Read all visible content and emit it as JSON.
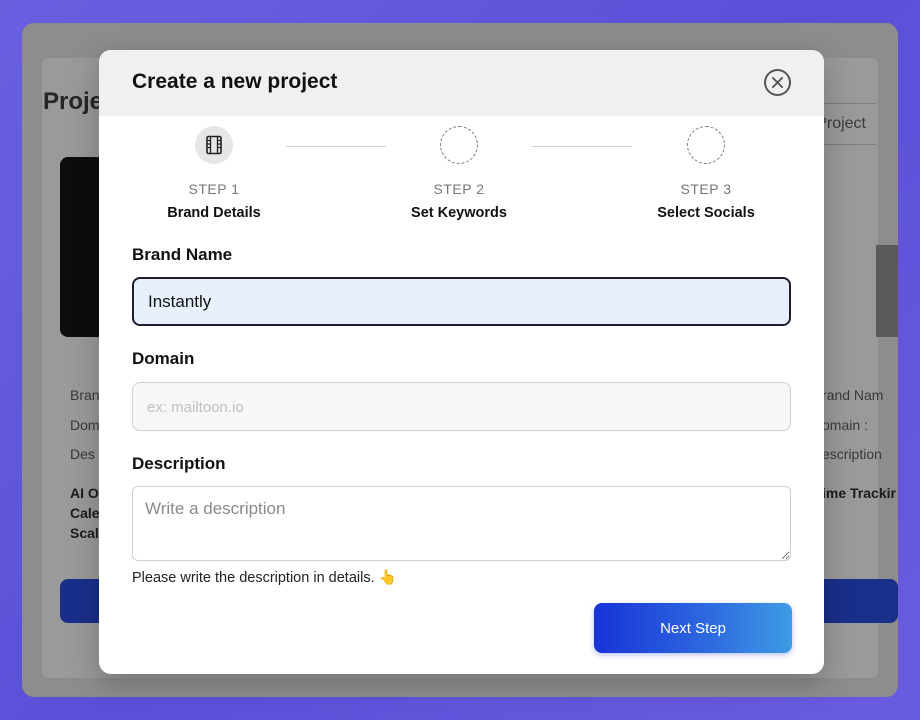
{
  "background": {
    "page_title": "Proje",
    "all_projects_label": "ll Project",
    "left_fields": [
      "Bran",
      "Dom",
      "Des"
    ],
    "left_tags": [
      "AI O",
      "Cale",
      "Scal"
    ],
    "right_fields": [
      "rand Nam",
      "omain :",
      "escription"
    ],
    "right_tags": [
      "ime Trackir"
    ]
  },
  "modal": {
    "title": "Create a new project",
    "close_icon": "close-icon",
    "steps": [
      {
        "number": "STEP 1",
        "label": "Brand Details",
        "state": "active",
        "icon": "film-icon"
      },
      {
        "number": "STEP 2",
        "label": "Set Keywords",
        "state": "pending"
      },
      {
        "number": "STEP 3",
        "label": "Select Socials",
        "state": "pending"
      }
    ],
    "brand": {
      "label": "Brand Name",
      "value": "Instantly"
    },
    "domain": {
      "label": "Domain",
      "value": "",
      "placeholder": "ex: mailtoon.io"
    },
    "description": {
      "label": "Description",
      "value": "",
      "placeholder": "Write a description"
    },
    "helper_text": "Please write the description in details. 👆",
    "next_label": "Next Step"
  },
  "colors": {
    "accent_start": "#1733d6",
    "accent_end": "#3d9be4",
    "brand_input_bg": "#e8f0fe"
  }
}
